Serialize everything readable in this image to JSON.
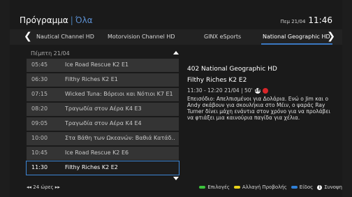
{
  "header": {
    "title": "Πρόγραμμα",
    "separator": "|",
    "category": "Όλα",
    "date": "Πεμ 21/04",
    "time": "11:46"
  },
  "channels": {
    "items": [
      "Nautical Channel HD",
      "Motorvision Channel HD",
      "GINX eSports",
      "National Geographic HD"
    ],
    "active_index": 3
  },
  "day_label": "Πέμπτη 21/04",
  "schedule": [
    {
      "time": "05:45",
      "title": "Ice Road Rescue K2 E1"
    },
    {
      "time": "06:30",
      "title": "Filthy Riches K2 E1"
    },
    {
      "time": "07:15",
      "title": "Wicked Tuna: Βόρειοι και Νότιοι K7 E1"
    },
    {
      "time": "08:20",
      "title": "Τραγωδία στον Αέρα K4 E3"
    },
    {
      "time": "09:05",
      "title": "Τραγωδία στον Αέρα K4 E4"
    },
    {
      "time": "10:00",
      "title": "Στα Βάθη των Ωκεανών: Βαθιά Κατάδ…"
    },
    {
      "time": "10:45",
      "title": "Ice Road Rescue K2 E6"
    },
    {
      "time": "11:30",
      "title": "Filthy Riches K2 E2"
    }
  ],
  "selected_row": 7,
  "details": {
    "channel": "402 National Geographic HD",
    "title": "Filthy Riches K2 E2",
    "meta": "11:30 - 12:20 21/04 | 50'",
    "rating_badge": "18",
    "description": "Επεισόδιο: Απελπισμένοι για Δολάρια. Ενώ ο Jim και ο Andy σκάβουν για σκουλήκια στο Μέιν, ο ψαράς Ray Turner δίνει μάχη ενάντια στον χρόνο για να προλάβει να φτιάξει μια καινούρια παγίδα για χέλια."
  },
  "footer": {
    "hours": "◂◂ 24 ώρες ▸▸",
    "legend": [
      {
        "label": "Επιλογές",
        "color": "#3cc23c"
      },
      {
        "label": "Αλλαγή Προβολής",
        "color": "#e8d21a"
      },
      {
        "label": "Είδος",
        "color": "#2f7fd6"
      },
      {
        "label": "Συνοψη",
        "color": "#ffffff"
      }
    ],
    "info_glyph": "i"
  },
  "colors": {
    "accent": "#3d86d6",
    "background": "#1a1a1a",
    "row": "#343434"
  }
}
